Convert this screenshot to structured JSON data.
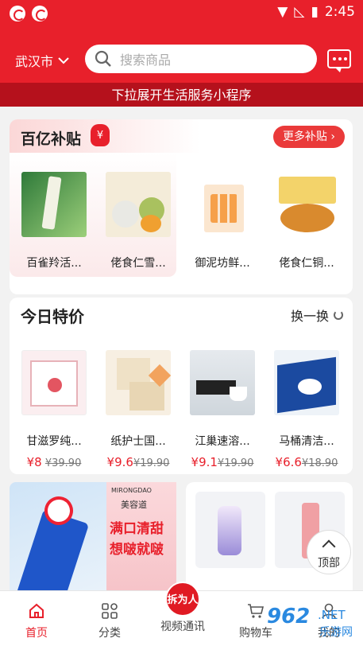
{
  "status_bar": {
    "time": "2:45"
  },
  "header": {
    "city": "武汉市",
    "search_placeholder": "搜索商品"
  },
  "banner": {
    "text": "下拉展开生活服务小程序"
  },
  "subsidy": {
    "title": "百亿补贴",
    "more_label": "更多补贴",
    "badge": "¥",
    "items": [
      {
        "name": "百雀羚活..."
      },
      {
        "name": "佬食仁雪..."
      },
      {
        "name": "御泥坊鲜..."
      },
      {
        "name": "佬食仁铜..."
      }
    ]
  },
  "today": {
    "title": "今日特价",
    "refresh_label": "换一换",
    "items": [
      {
        "name": "甘滋罗纯...",
        "price": "¥8",
        "old_price": "¥39.90"
      },
      {
        "name": "纸护士国...",
        "price": "¥9.6",
        "old_price": "¥19.90"
      },
      {
        "name": "江巢速溶...",
        "price": "¥9.1",
        "old_price": "¥19.90"
      },
      {
        "name": "马桶清洁...",
        "price": "¥6.6",
        "old_price": "¥18.90"
      }
    ]
  },
  "promo": {
    "brand_en": "MIRONGDAO",
    "brand_cn": "美容道",
    "line1": "满口清甜",
    "line2": "想啵就啵"
  },
  "top_button": {
    "label": "顶部"
  },
  "tabs": [
    {
      "label": "首页"
    },
    {
      "label": "分类"
    },
    {
      "label": "视频通讯",
      "badge": "拆为人"
    },
    {
      "label": "购物车"
    },
    {
      "label": "我的"
    }
  ],
  "watermark": {
    "logo": "962",
    "net": ".NET",
    "text": "乐游网"
  },
  "colors": {
    "brand": "#e8202b",
    "banner": "#b5111c"
  }
}
